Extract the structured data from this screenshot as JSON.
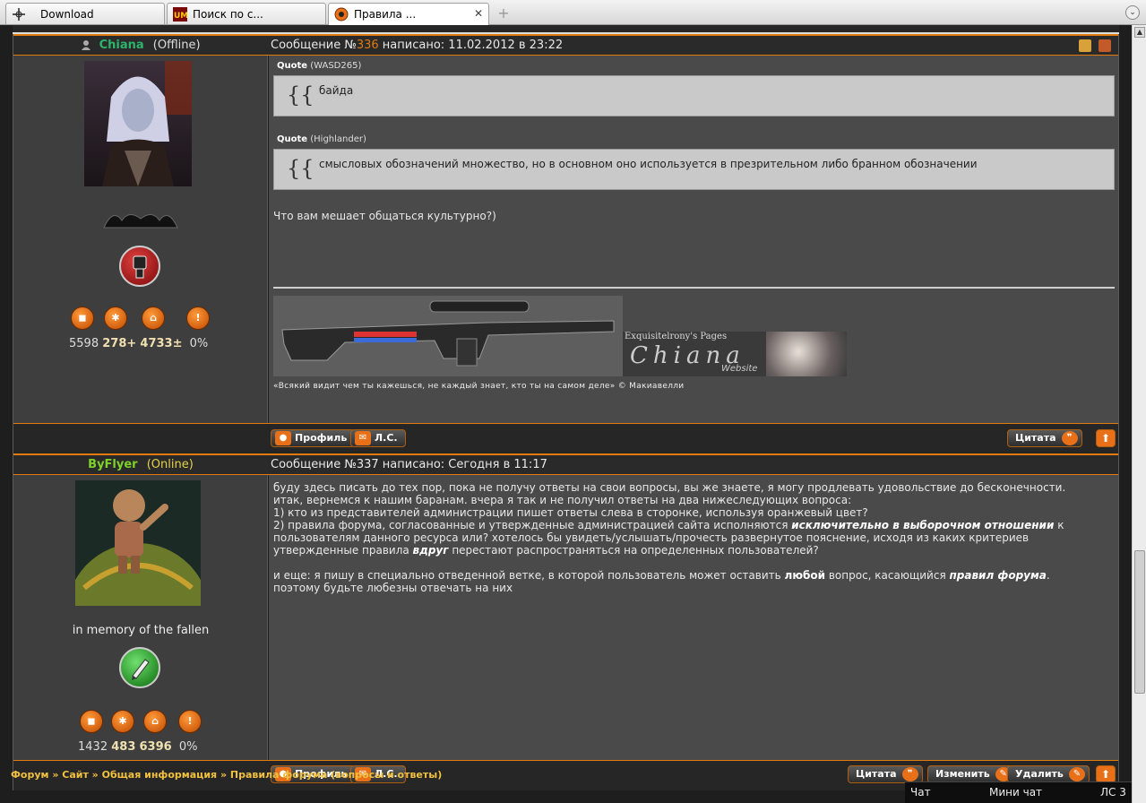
{
  "browser": {
    "tabs": [
      {
        "label": "Download",
        "icon": "crosshair-icon"
      },
      {
        "label": "Поиск по с...",
        "icon": "um-logo-icon"
      },
      {
        "label": "Правила ...",
        "icon": "site-favicon-icon",
        "active": true
      }
    ],
    "close_glyph": "✕",
    "new_tab_glyph": "+"
  },
  "posts": [
    {
      "user": {
        "name": "Chiana",
        "status": "(Offline)",
        "name_color": "#2db36b",
        "status_color": "#dddddd"
      },
      "title_prefix": "Сообщение №",
      "number": "336",
      "title_suffix": " написано: 11.02.2012 в 23:22",
      "quotes": [
        {
          "label": "Quote",
          "author": "(WASD265)",
          "text": "байда"
        },
        {
          "label": "Quote",
          "author": "(Highlander)",
          "text": "смысловых обозначений множество, но в основном оно используется в презрительном либо бранном обозначении"
        }
      ],
      "body": "Что вам мешает общаться культурно?)",
      "banner_text": "Exquisitelrony's Pages",
      "banner_name": "Chiana",
      "banner_sub": "Website",
      "signature": "«Всякий видит чем ты кажешься, не каждый знает, кто ты на самом деле» © Макиавелли",
      "stats": {
        "a": "5598",
        "b": "278+",
        "c": "4733±",
        "d": "0%"
      },
      "rank_color": "#b01818",
      "rank_icon": "fist-icon"
    },
    {
      "user": {
        "name": "ByFlyer",
        "status": "(Online)",
        "name_color": "#7fd12a",
        "status_color": "#e6d24a"
      },
      "title_prefix": "Сообщение №",
      "number": "337",
      "title_suffix": " написано: Сегодня в 11:17",
      "motto": "in memory of the fallen",
      "body_lines": [
        "буду здесь писать до тех пор, пока не получу ответы на свои вопросы, вы же знаете, я могу продлевать удовольствие до бесконечности.",
        "итак, вернемся к нашим баранам. вчера я так и не получил ответы на два нижеследующих вопроса:",
        "1) кто из представителей администрации пишет ответы слева в сторонке, используя оранжевый цвет?"
      ],
      "q2_pre": "2) правила форума, согласованные и утвержденные администрацией сайта исполняются ",
      "q2_emph": "исключительно в выборочном отношении",
      "q2_post": " к пользователям данного ресурса или? хотелось бы увидеть/услышать/прочесть развернутое пояснение, исходя из каких критериев утвержденные правила ",
      "q2_emph2": "вдруг",
      "q2_end": " перестают распространяться на определенных пользователей?",
      "p3_pre": "и еще: я пишу в специально отведенной ветке, в которой пользователь может оставить ",
      "p3_emph": "любой",
      "p3_mid": " вопрос, касающийся ",
      "p3_emph2": "правил форума",
      "p3_end": ".",
      "p3_line2": "поэтому будьте любезны отвечать на них",
      "stats": {
        "a": "1432",
        "b": "483",
        "c": "6396",
        "d": "0%"
      },
      "rank_color": "#2e9a2e",
      "rank_icon": "pencil-icon"
    }
  ],
  "buttons": {
    "profile": "Профиль",
    "pm": "Л.С.",
    "quote": "Цитата",
    "edit": "Изменить",
    "delete": "Удалить"
  },
  "breadcrumb": "Форум » Сайт » Общая информация » Правила форума (вопросы и ответы)",
  "chatbar": {
    "chat": "Чат",
    "mini_chat": "Мини чат",
    "pm": "ЛС 3"
  }
}
